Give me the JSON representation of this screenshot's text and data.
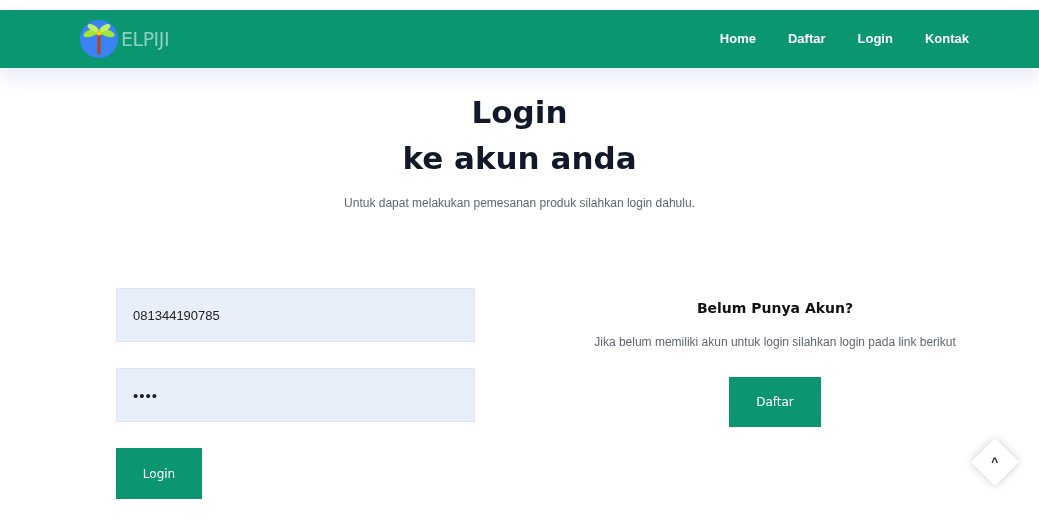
{
  "header": {
    "brand": "ELPIJI",
    "nav": [
      {
        "label": "Home"
      },
      {
        "label": "Daftar"
      },
      {
        "label": "Login"
      },
      {
        "label": "Kontak"
      }
    ]
  },
  "title": [
    "Login",
    "ke akun anda"
  ],
  "subtitle": "Untuk dapat melakukan pemesanan produk silahkan login dahulu.",
  "form": {
    "fields": [
      {
        "kind": "text",
        "value": "081344190785"
      },
      {
        "kind": "password",
        "value": "••••"
      }
    ],
    "button": "Login"
  },
  "register": {
    "heading": "Belum Punya Akun?",
    "text": "Jika belum memiliki akun untuk login silahkan login pada link berikut",
    "button": "Daftar"
  },
  "scroll_top": "^"
}
